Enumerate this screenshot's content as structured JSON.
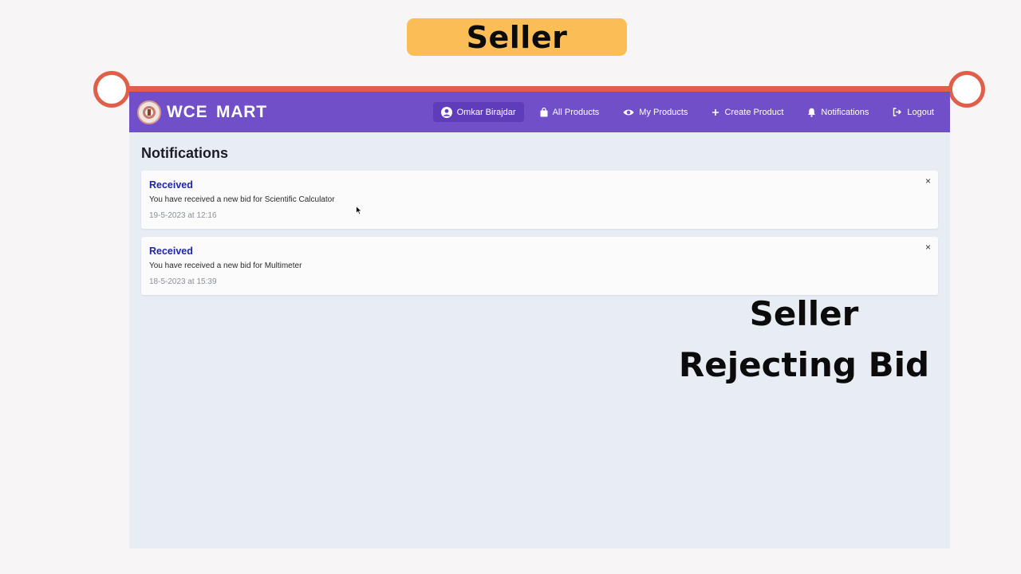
{
  "banner": {
    "label": "Seller"
  },
  "caption": {
    "line1": "Seller",
    "line2": "Rejecting Bid"
  },
  "navbar": {
    "brand": "WCE MART",
    "user": "Omkar Birajdar",
    "items": [
      {
        "label": "All Products",
        "icon": "shopping-bag-icon"
      },
      {
        "label": "My Products",
        "icon": "eye-icon"
      },
      {
        "label": "Create Product",
        "icon": "plus-icon"
      },
      {
        "label": "Notifications",
        "icon": "bell-icon"
      },
      {
        "label": "Logout",
        "icon": "logout-icon"
      }
    ]
  },
  "page": {
    "title": "Notifications",
    "notifications": [
      {
        "title": "Received",
        "message": "You have received a new bid for Scientific Calculator",
        "time": "19-5-2023 at 12:16",
        "close": "×"
      },
      {
        "title": "Received",
        "message": "You have received a new bid for Multimeter",
        "time": "18-5-2023 at 15:39",
        "close": "×"
      }
    ]
  },
  "colors": {
    "navbar": "#714fc9",
    "accent_line": "#df5f48",
    "banner": "#fbbd56",
    "notification_title": "#1f24a8"
  }
}
